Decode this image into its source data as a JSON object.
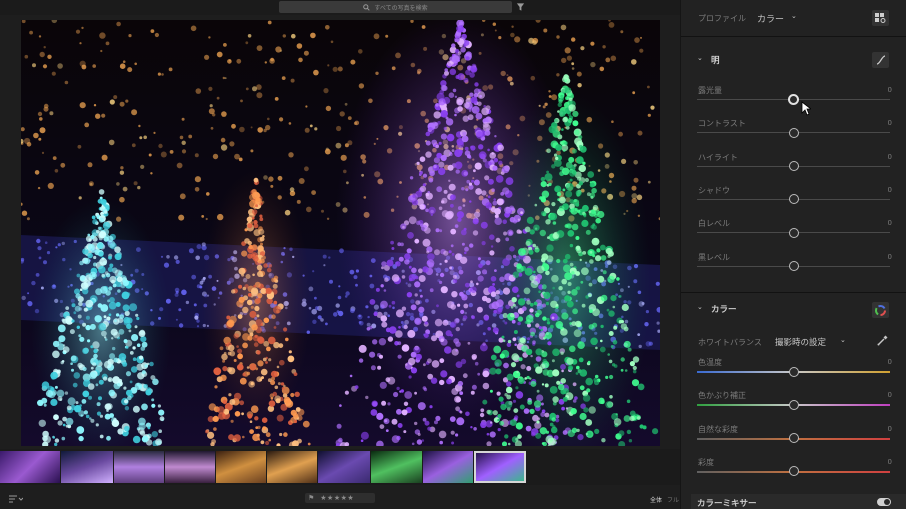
{
  "search": {
    "placeholder": "すべての写真を検索"
  },
  "bottom": {
    "view_all": "全体",
    "view_full": "フル",
    "stars": "★★★★★"
  },
  "profile": {
    "label": "プロファイル",
    "value": "カラー"
  },
  "light": {
    "title": "明",
    "sliders": [
      {
        "label": "露光量",
        "value": "0",
        "position": 0.5
      },
      {
        "label": "コントラスト",
        "value": "0",
        "position": 0.5
      },
      {
        "label": "ハイライト",
        "value": "0",
        "position": 0.5
      },
      {
        "label": "シャドウ",
        "value": "0",
        "position": 0.5
      },
      {
        "label": "白レベル",
        "value": "0",
        "position": 0.5
      },
      {
        "label": "黒レベル",
        "value": "0",
        "position": 0.5
      }
    ]
  },
  "color": {
    "title": "カラー",
    "wb_label": "ホワイトバランス",
    "wb_value": "撮影時の設定",
    "sliders": [
      {
        "label": "色温度",
        "value": "0",
        "position": 0.5
      },
      {
        "label": "色かぶり補正",
        "value": "0",
        "position": 0.5
      },
      {
        "label": "自然な彩度",
        "value": "0",
        "position": 0.5
      },
      {
        "label": "彩度",
        "value": "0",
        "position": 0.5
      }
    ]
  },
  "mixer": {
    "title": "カラーミキサー"
  },
  "colors": {
    "accent": "#e2e2e2",
    "panel_bg": "#222222",
    "photo_purple": "#a45cff",
    "photo_green": "#3cff8c",
    "photo_cyan": "#7ff6ff",
    "photo_orange": "#ff9a40"
  }
}
